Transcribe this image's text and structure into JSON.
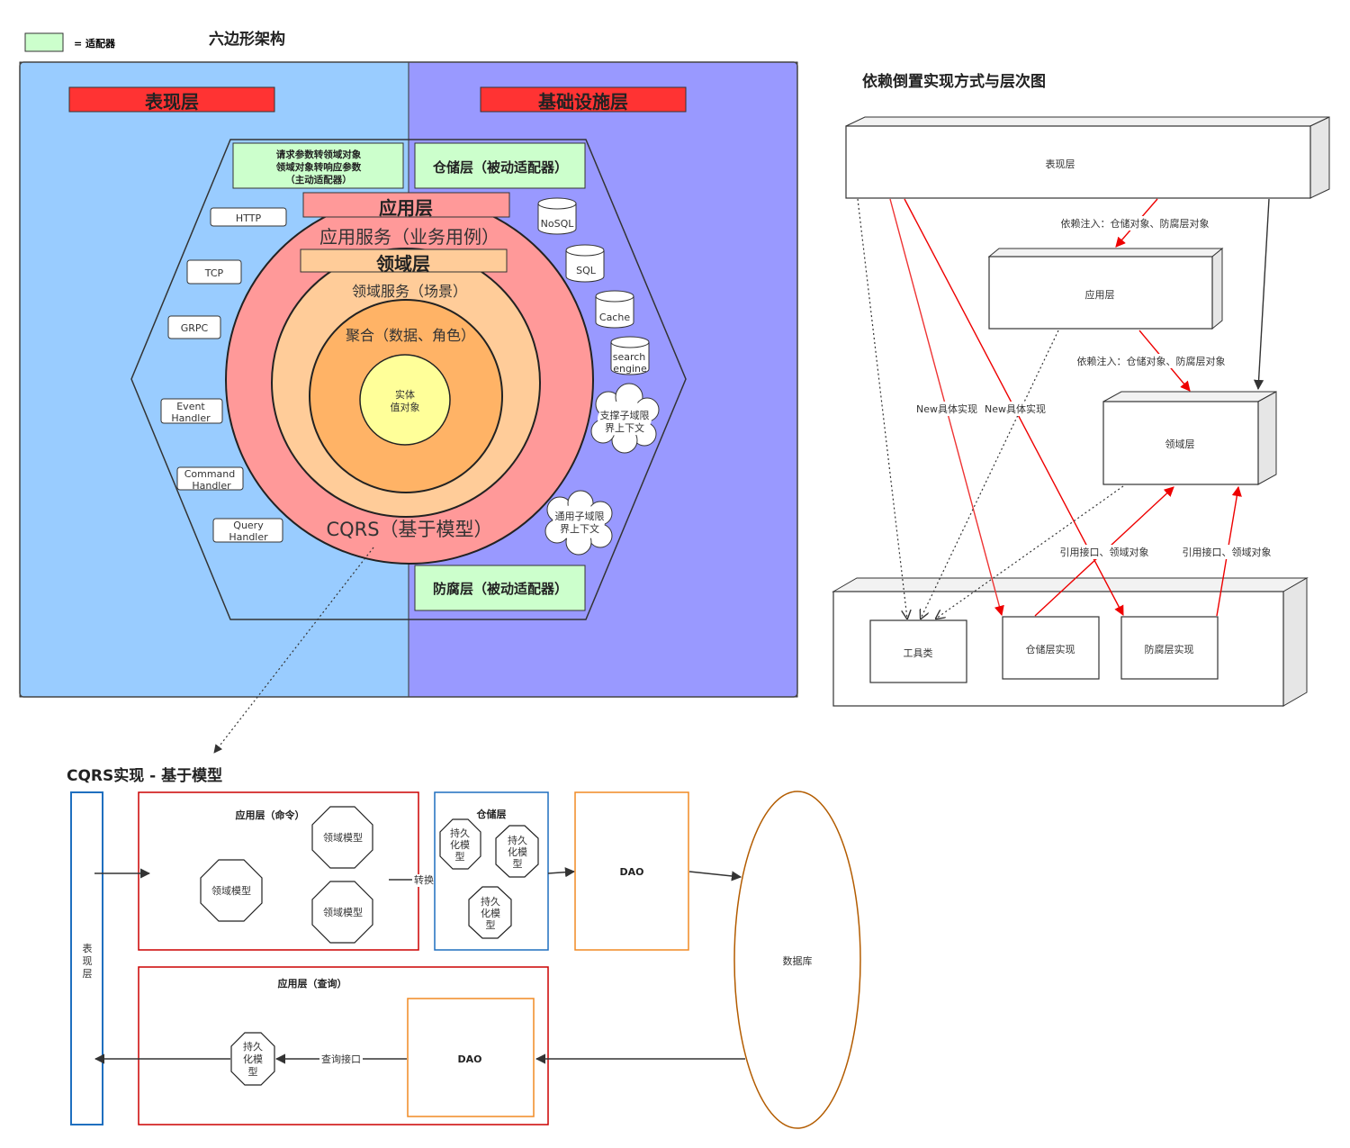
{
  "legend": {
    "label": "= 适配器",
    "swatch_color": "#ccffcc"
  },
  "hexagon": {
    "title": "六边形架构",
    "presentation_label": "表现层",
    "infrastructure_label": "基础设施层",
    "active_adapter_lines": [
      "请求参数转领域对象",
      "领域对象转响应参数",
      "（主动适配器）"
    ],
    "repository_adapter": "仓储层（被动适配器）",
    "anticorruption_adapter": "防腐层（被动适配器）",
    "application_layer": "应用层",
    "application_service": "应用服务（业务用例）",
    "domain_layer": "领域层",
    "domain_service": "领域服务（场景）",
    "aggregate": "聚合（数据、角色）",
    "entity_lines": [
      "实体",
      "值对象"
    ],
    "cqrs": "CQRS（基于模型）",
    "inputs": [
      "HTTP",
      "TCP",
      "GRPC"
    ],
    "event_handler": [
      "Event",
      "Handler"
    ],
    "command_handler": [
      "Command",
      "Handler"
    ],
    "query_handler": [
      "Query",
      "Handler"
    ],
    "datastores": [
      "NoSQL",
      "SQL",
      "Cache"
    ],
    "search_engine": [
      "search",
      "engine"
    ],
    "cloud_supporting": [
      "支撑子域限",
      "界上下文"
    ],
    "cloud_generic": [
      "通用子域限",
      "界上下文"
    ],
    "colors": {
      "left_bg": "#99ccff",
      "right_bg": "#9999ff",
      "red_bar": "#ff3333",
      "ring_outer": "#ff9999",
      "ring_mid": "#ffcc99",
      "ring_inner": "#ffb366",
      "core": "#ffff99"
    }
  },
  "dip": {
    "title": "依赖倒置实现方式与层次图",
    "presentation": "表现层",
    "application": "应用层",
    "domain": "领域层",
    "utils": "工具类",
    "repository_impl": "仓储层实现",
    "anticorruption_impl": "防腐层实现",
    "di_label_1": "依赖注入：仓储对象、防腐层对象",
    "di_label_2": "依赖注入：仓储对象、防腐层对象",
    "new_label_1": "New具体实现",
    "new_label_2": "New具体实现",
    "ref_label_1": "引用接口、领域对象",
    "ref_label_2": "引用接口、领域对象"
  },
  "cqrs": {
    "title": "CQRS实现 - 基于模型",
    "presentation_chars": [
      "表",
      "现",
      "层"
    ],
    "command_title": "应用层（命令）",
    "domain_model": "领域模型",
    "convert": "转换",
    "repository_title": "仓储层",
    "persist_lines": [
      "持久",
      "化模",
      "型"
    ],
    "dao": "DAO",
    "database": "数据库",
    "query_title": "应用层（查询）",
    "query_interface": "查询接口"
  }
}
